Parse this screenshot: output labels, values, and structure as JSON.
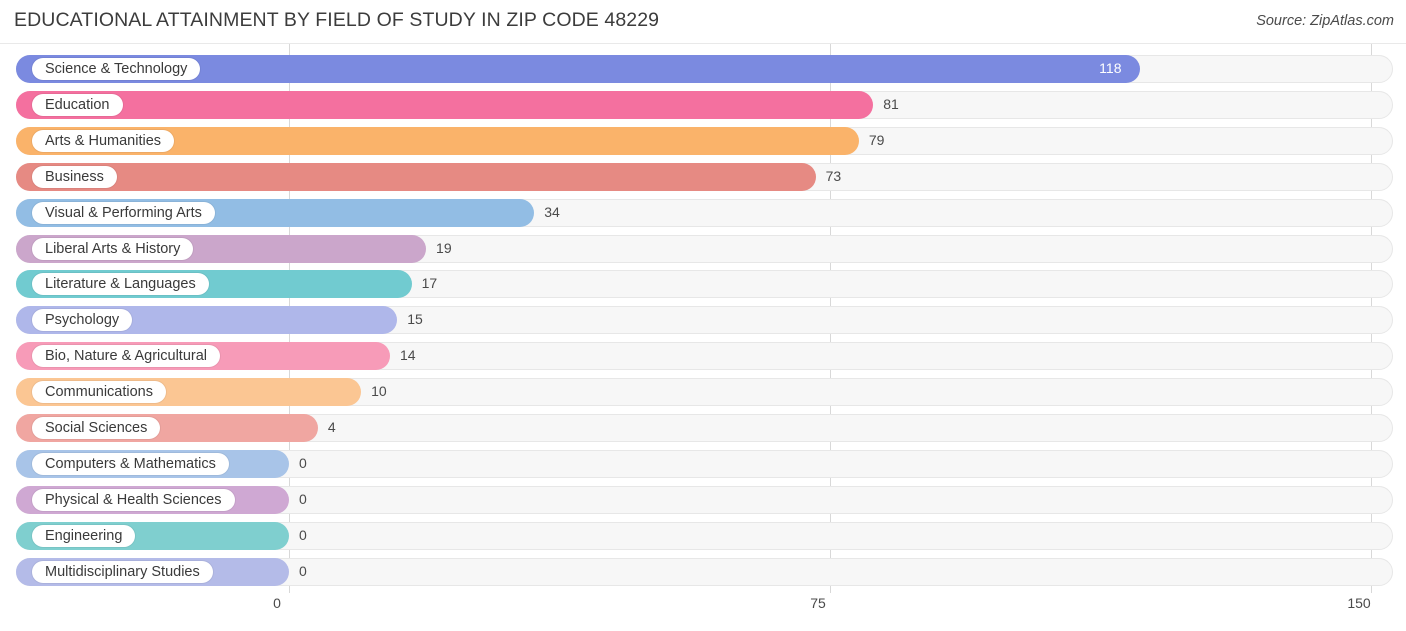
{
  "header": {
    "title": "EDUCATIONAL ATTAINMENT BY FIELD OF STUDY IN ZIP CODE 48229",
    "source": "Source: ZipAtlas.com"
  },
  "chart_data": {
    "type": "bar",
    "orientation": "horizontal",
    "title": "EDUCATIONAL ATTAINMENT BY FIELD OF STUDY IN ZIP CODE 48229",
    "source": "Source: ZipAtlas.com",
    "xlabel": "",
    "ylabel": "",
    "xlim": [
      0,
      150
    ],
    "xticks": [
      0,
      75,
      150
    ],
    "xtick_labels": [
      "0",
      "75",
      "150"
    ],
    "grid": true,
    "legend": false,
    "categories": [
      "Science & Technology",
      "Education",
      "Arts & Humanities",
      "Business",
      "Visual & Performing Arts",
      "Liberal Arts & History",
      "Literature & Languages",
      "Psychology",
      "Bio, Nature & Agricultural",
      "Communications",
      "Social Sciences",
      "Computers & Mathematics",
      "Physical & Health Sciences",
      "Engineering",
      "Multidisciplinary Studies"
    ],
    "values": [
      118,
      81,
      79,
      73,
      34,
      19,
      17,
      15,
      14,
      10,
      4,
      0,
      0,
      0,
      0
    ],
    "value_labels": [
      "118",
      "81",
      "79",
      "73",
      "34",
      "19",
      "17",
      "15",
      "14",
      "10",
      "4",
      "0",
      "0",
      "0",
      "0"
    ],
    "colors": [
      "#7b8ae0",
      "#f4709f",
      "#fab36a",
      "#e68a83",
      "#92bde4",
      "#cba6cb",
      "#71cbd0",
      "#afb7ea",
      "#f79bb8",
      "#fbc693",
      "#f0a6a1",
      "#a8c4e8",
      "#cfa8d3",
      "#7fcfcf",
      "#b4bbe8"
    ]
  },
  "axis": {
    "ticks": [
      "0",
      "75",
      "150"
    ]
  }
}
